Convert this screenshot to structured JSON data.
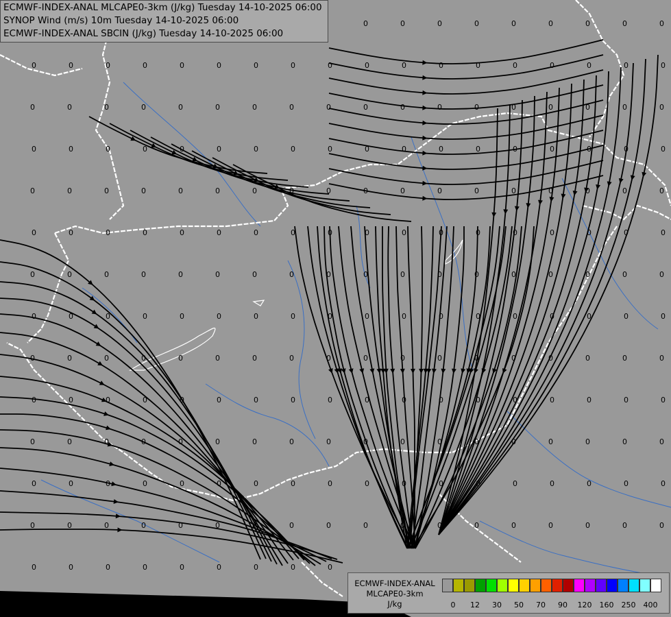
{
  "header": {
    "line1": "ECMWF-INDEX-ANAL MLCAPE0-3km (J/kg) Tuesday 14-10-2025 06:00",
    "line2": "SYNOP Wind (m/s) 10m Tuesday 14-10-2025 06:00",
    "line3": "ECMWF-INDEX-ANAL SBCIN (J/kg) Tuesday 14-10-2025 06:00"
  },
  "legend": {
    "title1": "ECMWF-INDEX-ANAL",
    "title2": "MLCAPE0-3km",
    "unit": "J/kg",
    "colors": [
      "#999999",
      "#b5b500",
      "#9a9a00",
      "#00a000",
      "#00e000",
      "#a0ff00",
      "#ffff00",
      "#ffd000",
      "#ffa000",
      "#ff6000",
      "#e02000",
      "#b00000",
      "#ff00ff",
      "#b000ff",
      "#6000ff",
      "#0000ff",
      "#0080ff",
      "#00e0ff",
      "#80ffff",
      "#ffffff"
    ],
    "ticks": [
      "0",
      "12",
      "30",
      "50",
      "70",
      "90",
      "120",
      "160",
      "250",
      "400"
    ]
  },
  "map": {
    "field_value": "0",
    "background": "#999999",
    "border_color": "#ffffff",
    "river_color": "#3a6fc4",
    "streamline_color": "#000000"
  }
}
